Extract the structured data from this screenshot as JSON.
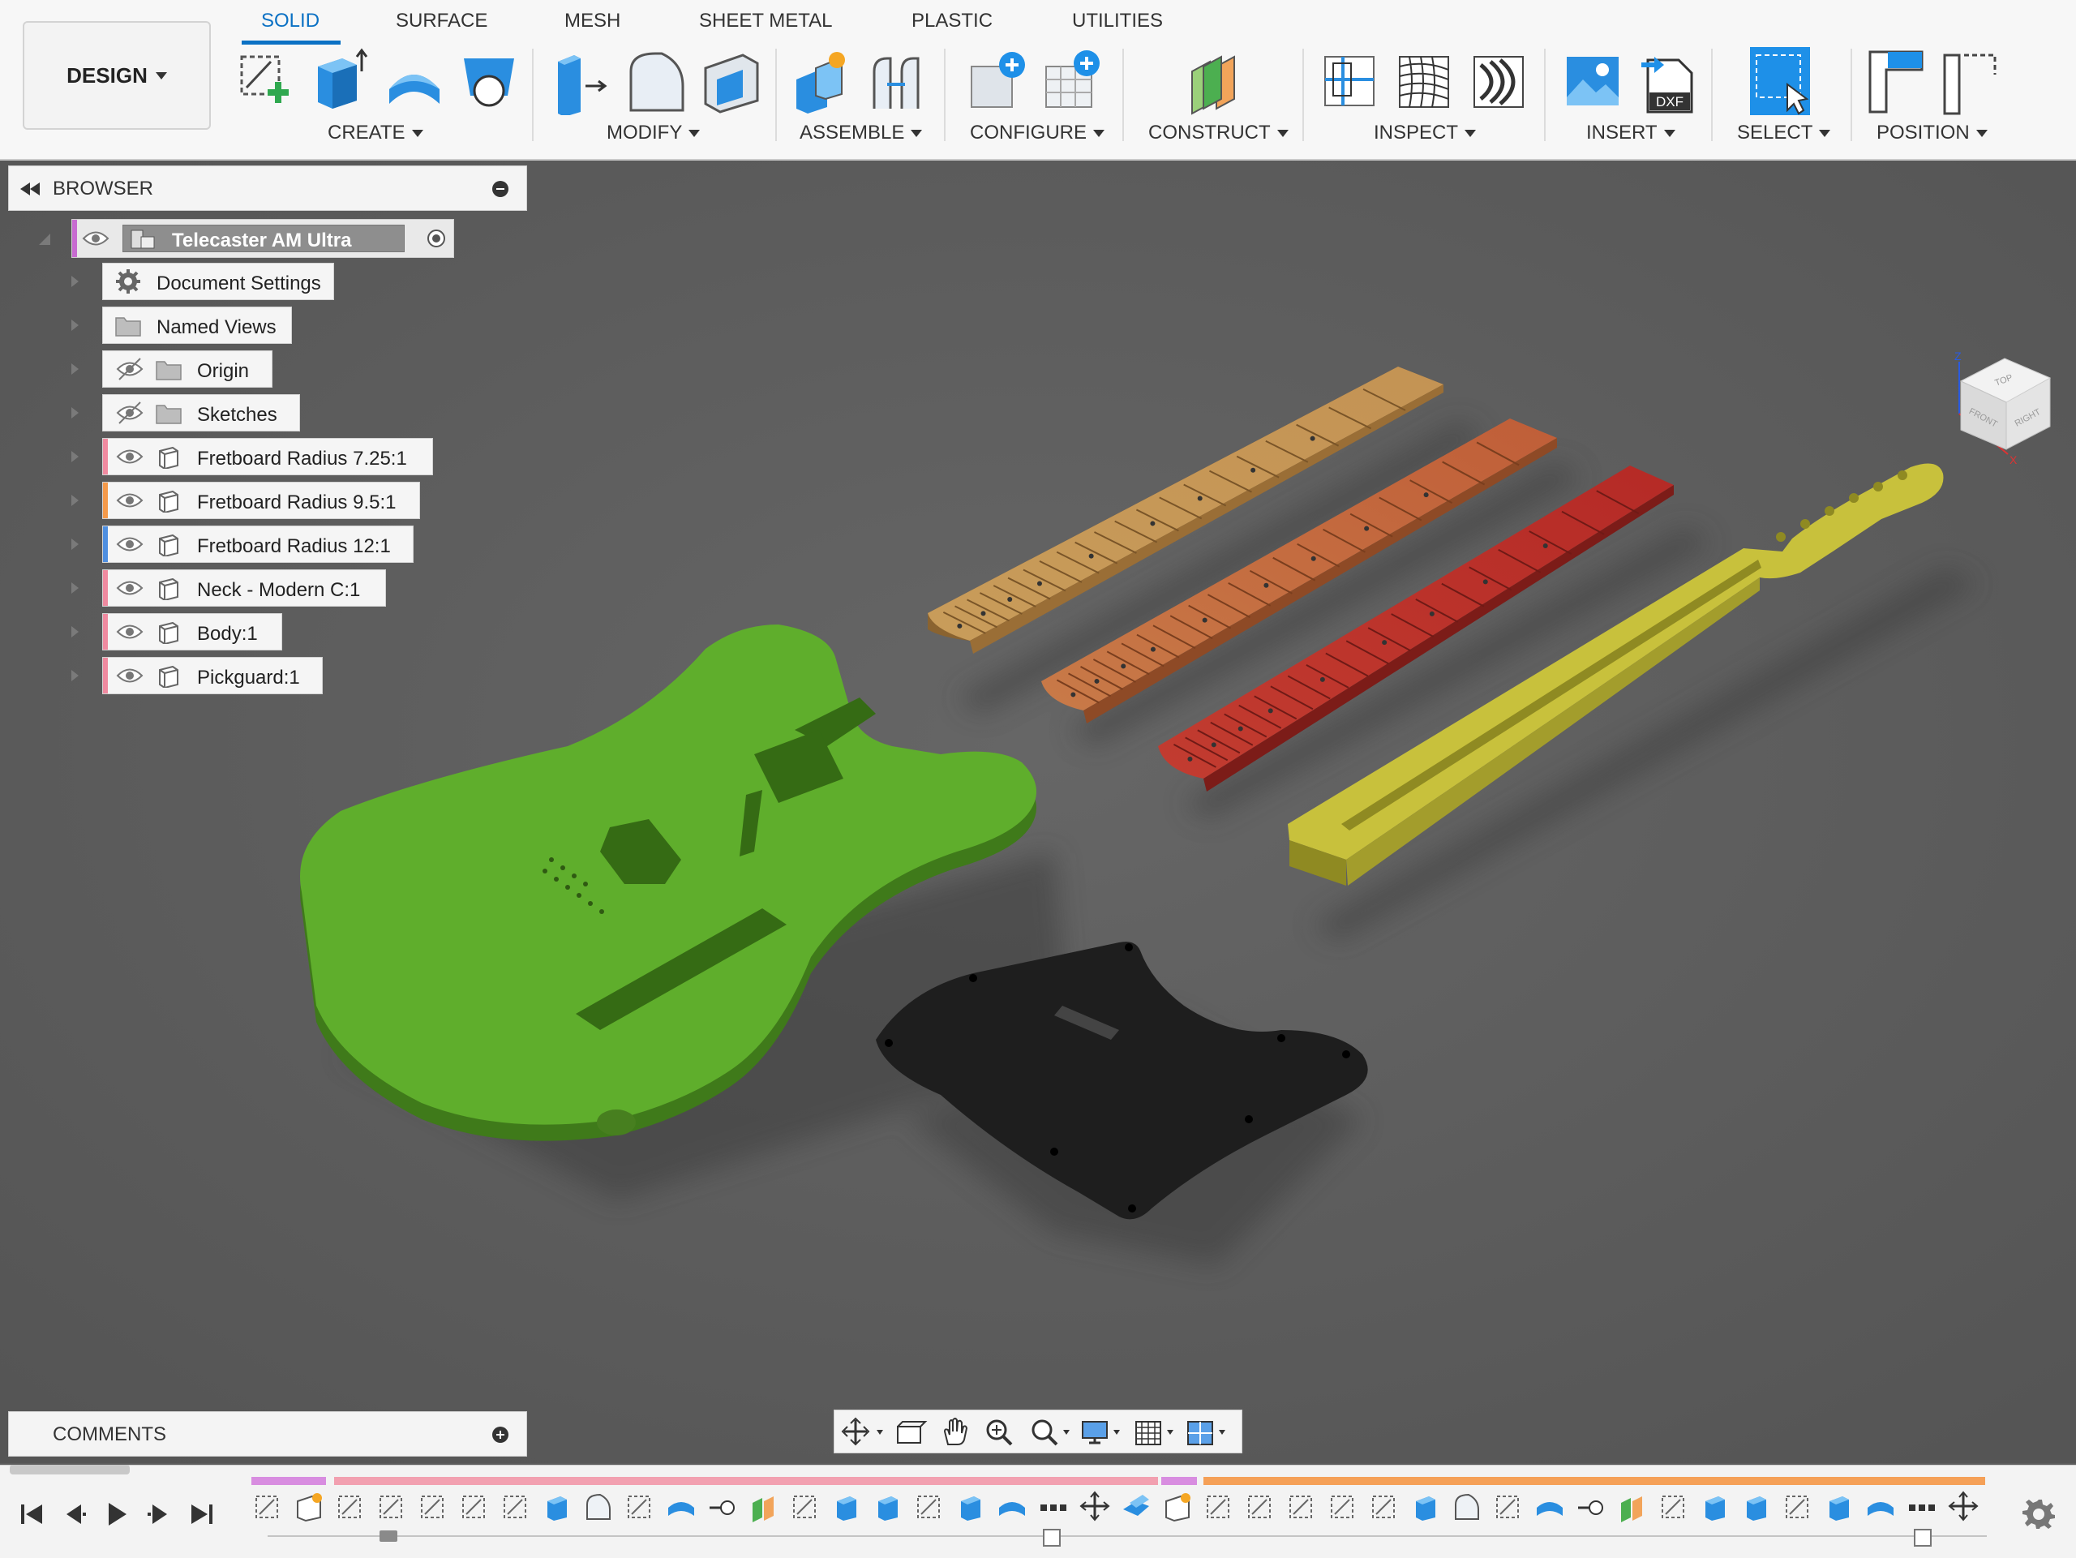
{
  "workspace": {
    "label": "DESIGN"
  },
  "tabs": [
    {
      "label": "SOLID",
      "active": true
    },
    {
      "label": "SURFACE",
      "active": false
    },
    {
      "label": "MESH",
      "active": false
    },
    {
      "label": "SHEET METAL",
      "active": false
    },
    {
      "label": "PLASTIC",
      "active": false
    },
    {
      "label": "UTILITIES",
      "active": false
    }
  ],
  "toolbar_groups": {
    "create": "CREATE",
    "modify": "MODIFY",
    "assemble": "ASSEMBLE",
    "configure": "CONFIGURE",
    "construct": "CONSTRUCT",
    "inspect": "INSPECT",
    "insert": "INSERT",
    "select": "SELECT",
    "position": "POSITION"
  },
  "toolbar_icons": [
    "create-sketch-icon",
    "extrude-icon",
    "revolve-icon",
    "hole-icon",
    "press-pull-icon",
    "fillet-icon",
    "shell-icon",
    "new-component-icon",
    "joint-icon",
    "configure-icon",
    "configure-table-icon",
    "offset-plane-icon",
    "measure-icon",
    "zebra-icon",
    "curvature-icon",
    "insert-image-icon",
    "insert-dxf-icon",
    "select-icon",
    "align-icon",
    "capture-position-icon"
  ],
  "insert_dxf_text": "DXF",
  "browser": {
    "title": "BROWSER",
    "root": "Telecaster AM Ultra",
    "items": [
      {
        "label": "Document Settings",
        "icon": "gear-icon",
        "color": ""
      },
      {
        "label": "Named Views",
        "icon": "folder-icon",
        "color": ""
      },
      {
        "label": "Origin",
        "icon": "folder-icon",
        "hidden": true,
        "color": ""
      },
      {
        "label": "Sketches",
        "icon": "folder-icon",
        "hidden": true,
        "color": ""
      },
      {
        "label": "Fretboard Radius 7.25:1",
        "icon": "component-icon",
        "color": "#f08aa0"
      },
      {
        "label": "Fretboard Radius 9.5:1",
        "icon": "component-icon",
        "color": "#f59a4a"
      },
      {
        "label": "Fretboard Radius 12:1",
        "icon": "component-icon",
        "color": "#4f8fe0"
      },
      {
        "label": "Neck - Modern C:1",
        "icon": "component-icon",
        "color": "#f08aa0"
      },
      {
        "label": "Body:1",
        "icon": "component-icon",
        "color": "#f08aa0"
      },
      {
        "label": "Pickguard:1",
        "icon": "component-icon",
        "color": "#f08aa0"
      }
    ]
  },
  "comments": {
    "title": "COMMENTS"
  },
  "navbar_icons": [
    "orbit-icon",
    "look-at-icon",
    "pan-icon",
    "zoom-icon",
    "fit-icon",
    "display-settings-icon",
    "grid-icon",
    "viewports-icon"
  ],
  "viewcube": {
    "faces": [
      "TOP",
      "FRONT",
      "RIGHT"
    ],
    "axes": [
      "Z",
      "X"
    ]
  },
  "colors": {
    "accent": "#0b71c4",
    "body": "#5aa82a",
    "neck": "#c8c23a",
    "fretboard_7_25": "#c69a4c",
    "fretboard_9_5": "#c06a3c",
    "fretboard_12": "#b8322a",
    "pickguard": "#1e1e1e",
    "viewport_bg": "#5c5c5c"
  },
  "timeline": {
    "playback": [
      "go-to-start-icon",
      "step-back-icon",
      "play-icon",
      "step-forward-icon",
      "go-to-end-icon"
    ]
  }
}
